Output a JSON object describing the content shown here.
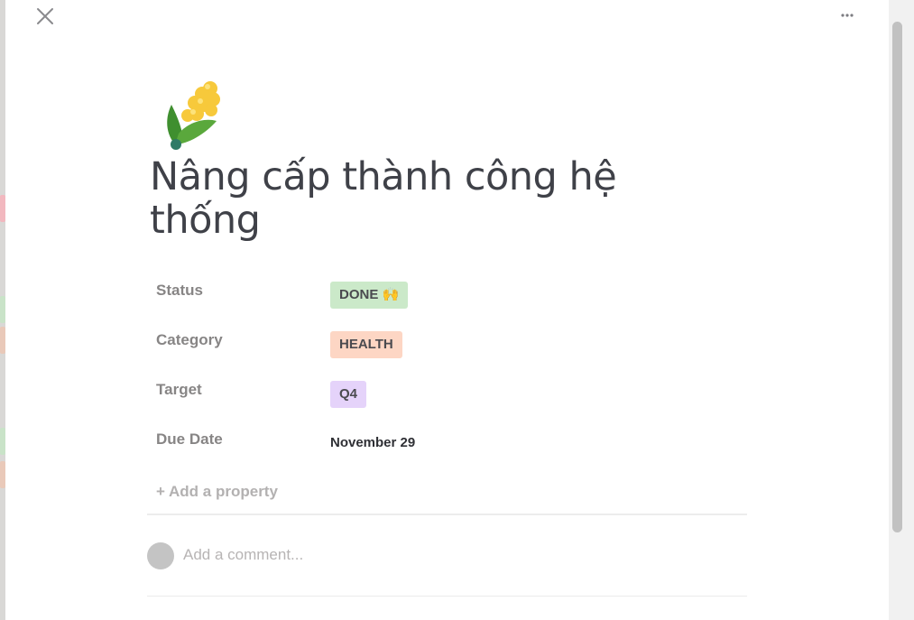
{
  "page": {
    "icon": "ear-of-corn-icon",
    "title": "Nâng cấp thành công hệ thống"
  },
  "properties": [
    {
      "label": "Status",
      "value": "DONE 🙌",
      "kind": "tag",
      "color": "#cbe9c9"
    },
    {
      "label": "Category",
      "value": "HEALTH",
      "kind": "tag",
      "color": "#fdd6c4"
    },
    {
      "label": "Target",
      "value": "Q4",
      "kind": "tag",
      "color": "#e5d3fa"
    },
    {
      "label": "Due Date",
      "value": "November 29",
      "kind": "date"
    }
  ],
  "add_property_label": "+ Add a property",
  "comment": {
    "placeholder": "Add a comment...",
    "value": ""
  },
  "toolbar": {
    "close_icon": "close-icon",
    "more_icon": "more-horizontal-icon"
  }
}
